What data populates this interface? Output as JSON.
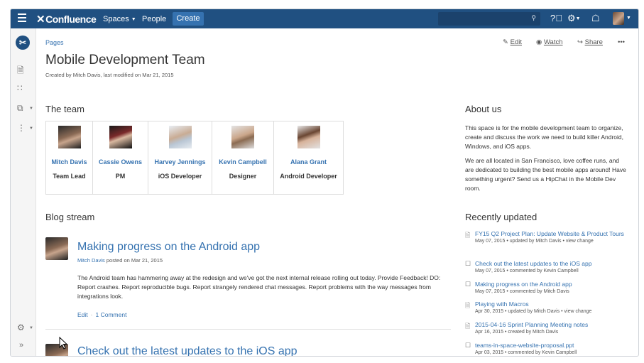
{
  "topnav": {
    "logo": "Confluence",
    "spaces": "Spaces",
    "people": "People",
    "create": "Create"
  },
  "breadcrumb": "Pages",
  "page": {
    "title": "Mobile Development Team",
    "byline": "Created by Mitch Davis, last modified on Mar 21, 2015"
  },
  "actions": {
    "edit": "Edit",
    "watch": "Watch",
    "share": "Share",
    "more": "•••"
  },
  "team": {
    "heading": "The team",
    "members": [
      {
        "name": "Mitch Davis",
        "role": "Team Lead"
      },
      {
        "name": "Cassie Owens",
        "role": "PM"
      },
      {
        "name": "Harvey Jennings",
        "role": "iOS Developer"
      },
      {
        "name": "Kevin Campbell",
        "role": "Designer"
      },
      {
        "name": "Alana Grant",
        "role": "Android Developer"
      }
    ]
  },
  "about": {
    "heading": "About us",
    "p1": "This space is for the mobile development team to organize, create and discuss the work we need to build killer Android, Windows, and iOS apps.",
    "p2": "We are all located in San Francisco, love coffee runs, and are dedicated to building the best mobile apps around! Have something urgent? Send us a HipChat in the Mobile Dev room."
  },
  "blog": {
    "heading": "Blog stream",
    "posts": [
      {
        "title": "Making progress on the Android app",
        "author": "Mitch Davis",
        "meta": " posted on Mar 21, 2015",
        "body": "The Android team has hammering away at the redesign and we've got the next internal release rolling out today. Provide Feedback! DO: Report crashes. Report reproducible bugs. Report strangely rendered chat messages. Report problems with the way messages from integrations look.",
        "edit": "Edit",
        "comments": "1 Comment"
      },
      {
        "title": "Check out the latest updates to the iOS app"
      }
    ]
  },
  "recent": {
    "heading": "Recently updated",
    "items": [
      {
        "icon": "page",
        "title": "FY15 Q2 Project Plan: Update Website & Product Tours",
        "meta": "May 07, 2015 • updated by Mitch Davis • view change"
      },
      {
        "icon": "blog",
        "title": "Check out the latest updates to the iOS app",
        "meta": "May 07, 2015 • commented by Kevin Campbell"
      },
      {
        "icon": "blog",
        "title": "Making progress on the Android app",
        "meta": "May 07, 2015 • commented by Mitch Davis"
      },
      {
        "icon": "page",
        "title": "Playing with Macros",
        "meta": "Apr 30, 2015 • updated by Mitch Davis • view change"
      },
      {
        "icon": "page",
        "title": "2015-04-16 Sprint Planning Meeting notes",
        "meta": "Apr 16, 2015 • created by Mitch Davis"
      },
      {
        "icon": "blog",
        "title": "teams-in-space-website-proposal.ppt",
        "meta": "Apr 03, 2015 • commented by Kevin Campbell"
      }
    ]
  },
  "colors": {
    "nav": "#205081",
    "link": "#3572b0",
    "create": "#3572b0"
  }
}
